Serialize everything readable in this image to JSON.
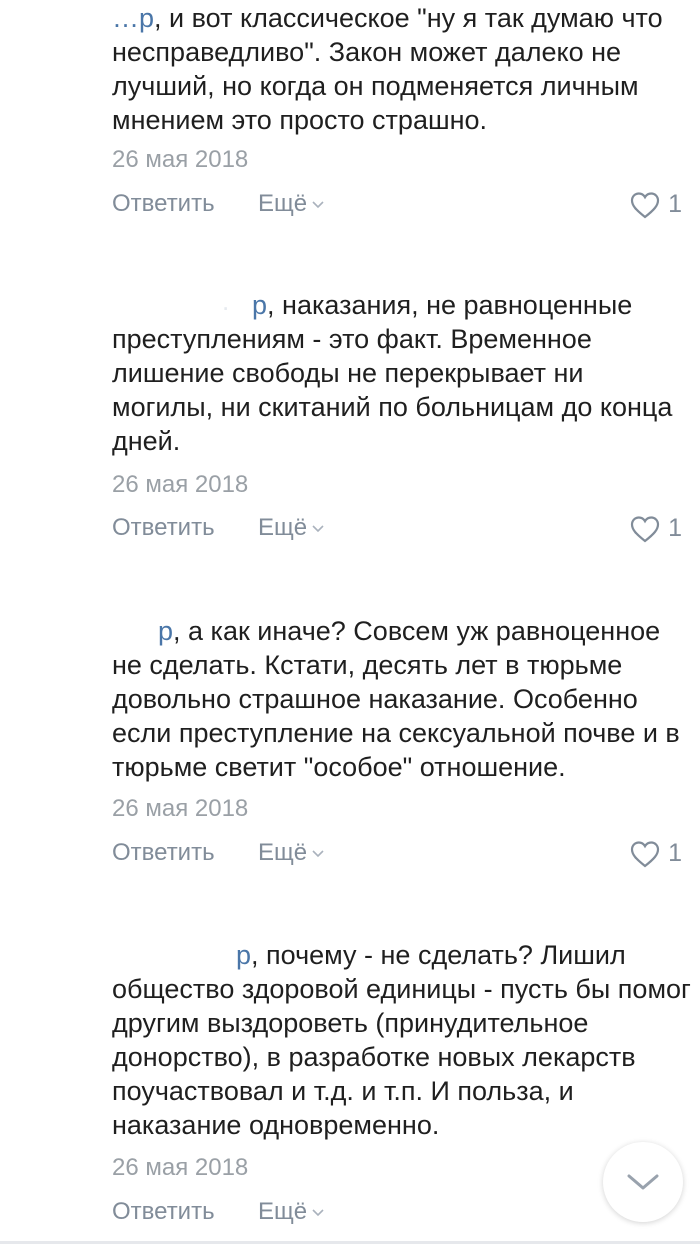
{
  "comments": [
    {
      "reply_to": "…р",
      "text": ", и вот классическое \"ну я так думаю что несправедливо\". Закон может далеко не лучший, но когда он подменяется личным мнением это просто страшно.",
      "date": "26 мая 2018",
      "reply_label": "Ответить",
      "more_label": "Ещё",
      "likes": "1"
    },
    {
      "reply_to": "р",
      "text": ", наказания, не равноценные преступлениям - это факт. Временное лишение свободы не перекрывает ни могилы, ни скитаний по больницам до конца дней.",
      "date": "26 мая 2018",
      "reply_label": "Ответить",
      "more_label": "Ещё",
      "likes": "1"
    },
    {
      "reply_to": "р",
      "text": ", а как иначе? Совсем уж равноценное не сделать. Кстати, десять лет в тюрьме довольно страшное наказание. Особенно если преступление на сексуальной почве и в тюрьме светит \"особое\" отношение.",
      "date": "26 мая 2018",
      "reply_label": "Ответить",
      "more_label": "Ещё",
      "likes": "1"
    },
    {
      "reply_to": "р",
      "text": ", почему - не сделать? Лишил общество здоровой единицы - пусть бы помог другим выздороветь (принудительное донорство), в разработке новых лекарств поучаствовал и т.д. и т.п. И польза, и наказание одновременно.",
      "date": "26 мая 2018",
      "reply_label": "Ответить",
      "more_label": "Ещё"
    }
  ],
  "icons": {
    "like": "heart-outline-icon",
    "more": "chevron-down-icon",
    "scroll": "chevron-down-icon"
  },
  "colors": {
    "link": "#4a76a8",
    "secondary": "#818c99",
    "date": "#9aa0a6"
  }
}
